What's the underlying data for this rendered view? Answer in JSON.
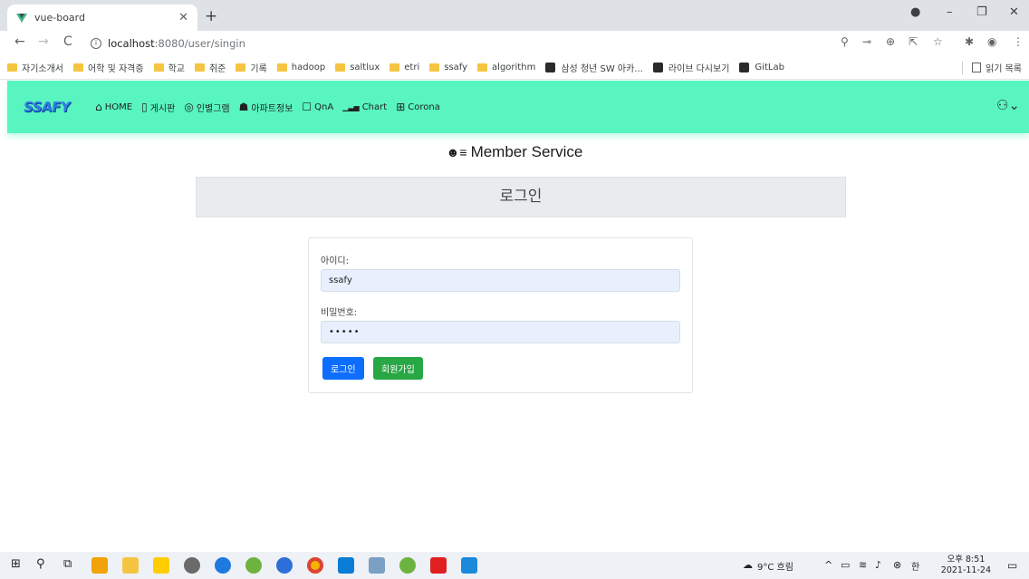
{
  "browser": {
    "tab_title": "vue-board",
    "url_host": "localhost",
    "url_path": ":8080/user/singin",
    "bookmarks": [
      "자기소개서",
      "어학 및 자격증",
      "학교",
      "취준",
      "기록",
      "hadoop",
      "saltlux",
      "etri",
      "ssafy",
      "algorithm"
    ],
    "gitlab_bookmarks": [
      "삼성 청년 SW 아카...",
      "라이브 다시보기",
      "GitLab"
    ],
    "reading_list": "읽기 목록"
  },
  "nav": {
    "brand": "SSAFY",
    "items": [
      {
        "icon": "home-icon",
        "glyph": "⌂",
        "label": "HOME"
      },
      {
        "icon": "board-icon",
        "glyph": "▯",
        "label": "게시판"
      },
      {
        "icon": "instagram-icon",
        "glyph": "◎",
        "label": "인별그램"
      },
      {
        "icon": "house-icon",
        "glyph": "☗",
        "label": "아파트정보"
      },
      {
        "icon": "chat-icon",
        "glyph": "☐",
        "label": "QnA"
      },
      {
        "icon": "chart-icon",
        "glyph": "▁▃▅",
        "label": "Chart"
      },
      {
        "icon": "plus-box-icon",
        "glyph": "⊞",
        "label": "Corona"
      }
    ]
  },
  "page": {
    "heading": "Member Service",
    "section_title": "로그인",
    "id_label": "아이디:",
    "id_value": "ssafy",
    "pw_label": "비밀번호:",
    "pw_value": "•••••",
    "login_button": "로그인",
    "signup_button": "회원가입"
  },
  "taskbar": {
    "weather": "9°C 흐림",
    "time": "오후 8:51",
    "date": "2021-11-24",
    "ime": "한"
  },
  "colors": {
    "navbar": "#58f5c0",
    "primary": "#0d6efd",
    "success": "#28a745"
  }
}
